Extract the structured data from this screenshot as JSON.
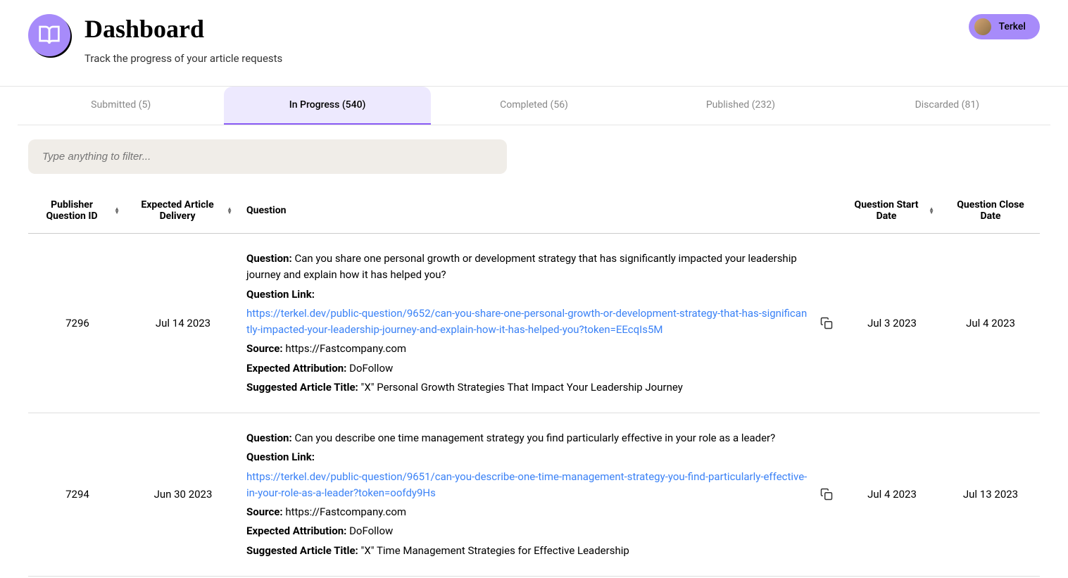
{
  "header": {
    "title": "Dashboard",
    "subtitle": "Track the progress of your article requests",
    "user_name": "Terkel"
  },
  "tabs": [
    {
      "label": "Submitted (5)",
      "active": false
    },
    {
      "label": "In Progress (540)",
      "active": true
    },
    {
      "label": "Completed (56)",
      "active": false
    },
    {
      "label": "Published (232)",
      "active": false
    },
    {
      "label": "Discarded (81)",
      "active": false
    }
  ],
  "filter": {
    "placeholder": "Type anything to filter..."
  },
  "columns": {
    "id": "Publisher Question ID",
    "delivery": "Expected Article Delivery",
    "question": "Question",
    "start": "Question Start Date",
    "close": "Question Close Date"
  },
  "labels": {
    "question": "Question:",
    "link": "Question Link:",
    "source": "Source:",
    "attribution": "Expected Attribution:",
    "suggested": "Suggested Article Title:"
  },
  "rows": [
    {
      "id": "7296",
      "delivery": "Jul 14 2023",
      "question_text": "Can you share one personal growth or development strategy that has significantly impacted your leadership journey and explain how it has helped you?",
      "link": "https://terkel.dev/public-question/9652/can-you-share-one-personal-growth-or-development-strategy-that-has-significantly-impacted-your-leadership-journey-and-explain-how-it-has-helped-you?token=EEcqIs5M",
      "source": "https://Fastcompany.com",
      "attribution": "DoFollow",
      "suggested": "\"X\" Personal Growth Strategies That Impact Your Leadership Journey",
      "start": "Jul 3 2023",
      "close": "Jul 4 2023"
    },
    {
      "id": "7294",
      "delivery": "Jun 30 2023",
      "question_text": "Can you describe one time management strategy you find particularly effective in your role as a leader?",
      "link": "https://terkel.dev/public-question/9651/can-you-describe-one-time-management-strategy-you-find-particularly-effective-in-your-role-as-a-leader?token=oofdy9Hs",
      "source": "https://Fastcompany.com",
      "attribution": "DoFollow",
      "suggested": "\"X\" Time Management Strategies for Effective Leadership",
      "start": "Jul 4 2023",
      "close": "Jul 13 2023"
    }
  ]
}
